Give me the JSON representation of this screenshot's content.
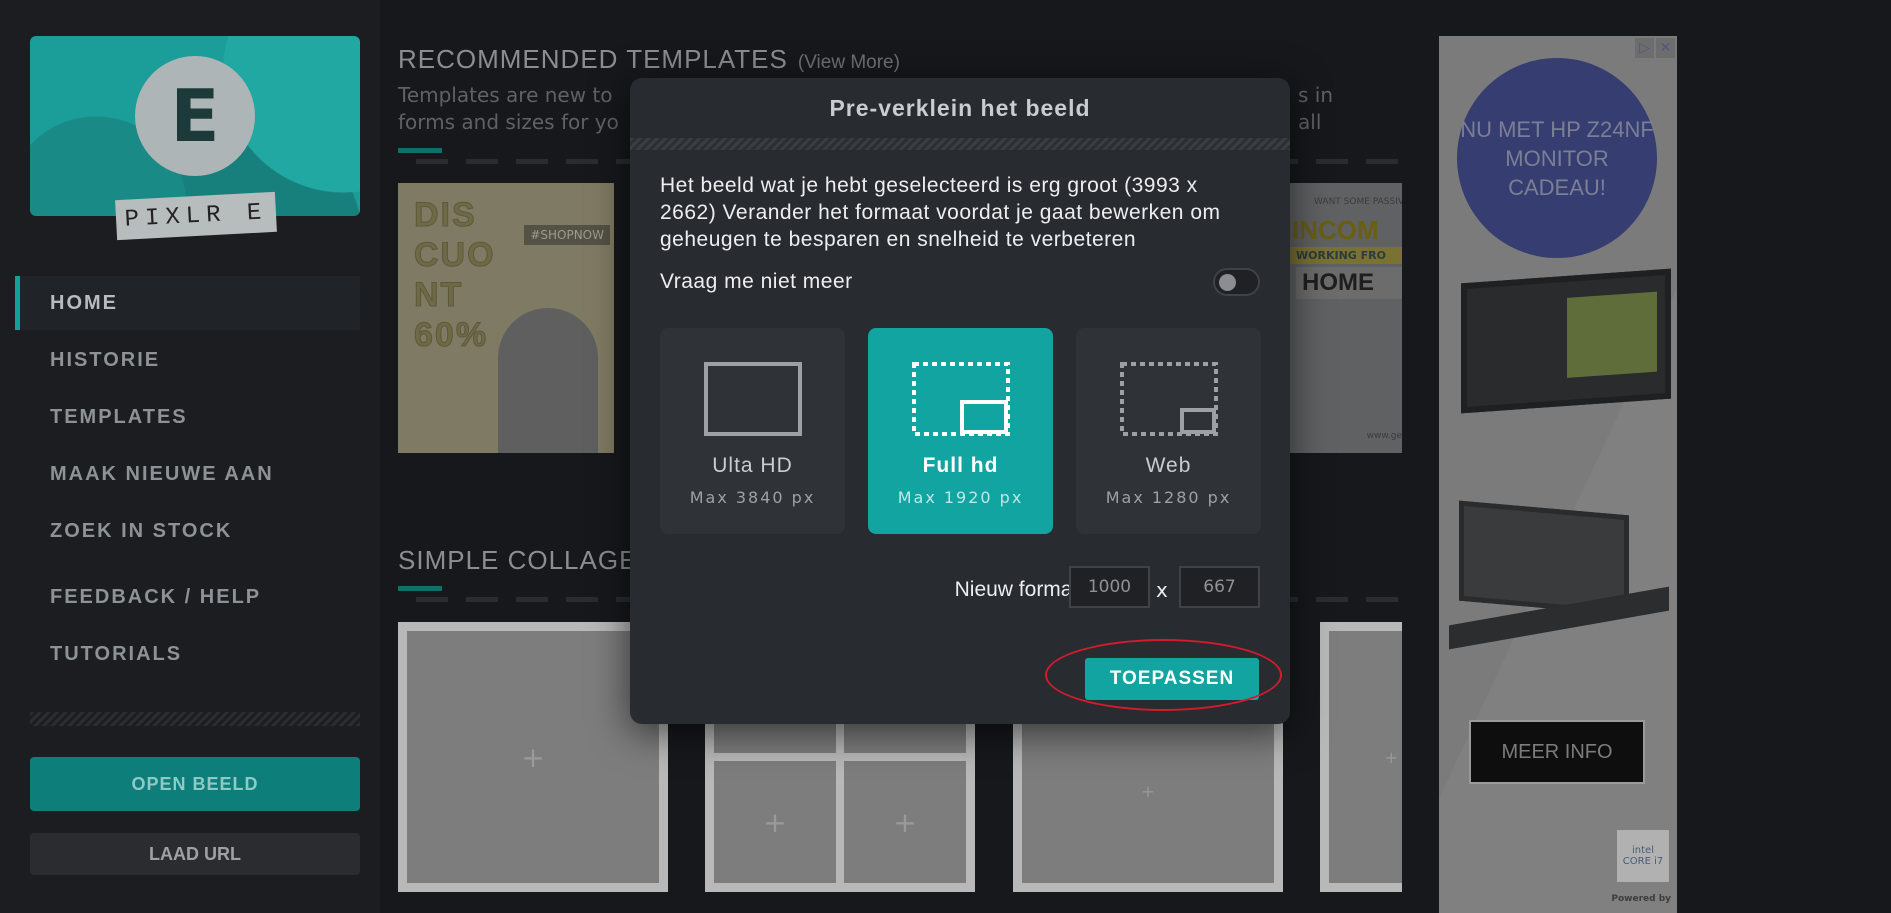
{
  "sidebar": {
    "logo_letter": "E",
    "logo_text": "PIXLR E",
    "nav": [
      {
        "label": "HOME",
        "active": true
      },
      {
        "label": "HISTORIE"
      },
      {
        "label": "TEMPLATES"
      },
      {
        "label": "MAAK NIEUWE AAN"
      },
      {
        "label": "ZOEK IN STOCK"
      },
      {
        "label": "FEEDBACK / HELP"
      },
      {
        "label": "TUTORIALS"
      }
    ],
    "open_button": "OPEN BEELD",
    "url_button": "LAAD URL"
  },
  "main": {
    "recommended_title": "RECOMMENDED TEMPLATES",
    "view_more": "(View More)",
    "recommended_desc_left": "Templates are new to",
    "recommended_desc_right": "s in all",
    "recommended_desc_line2": "forms and sizes for yo",
    "collage_title": "SIMPLE COLLAGE",
    "templates": {
      "discount_text": "DIS\nCUO\nNT\n60%",
      "discount_tag": "#SHOPNOW",
      "income_want": "WANT SOME PASSIV",
      "income_big": "INCOM",
      "income_working": "WORKING FRO",
      "income_home": "HOME",
      "income_url": "www.ge"
    },
    "plus": "+"
  },
  "ad": {
    "promo": "NU MET HP Z24NF MONITOR CADEAU!",
    "cta": "MEER INFO",
    "intel": "intel CORE i7",
    "powered": "Powered by"
  },
  "dialog": {
    "title": "Pre-verklein het beeld",
    "message": "Het beeld wat je hebt geselecteerd is erg groot (3993 x 2662) Verander het formaat voordat je gaat bewerken om geheugen te besparen en snelheid te verbeteren",
    "dont_ask": "Vraag me niet meer",
    "dont_ask_enabled": false,
    "options": [
      {
        "name": "Ulta HD",
        "max": "Max 3840 px",
        "selected": false
      },
      {
        "name": "Full hd",
        "max": "Max 1920 px",
        "selected": true
      },
      {
        "name": "Web",
        "max": "Max 1280 px",
        "selected": false
      }
    ],
    "format_label": "Nieuw formaat",
    "width_value": "1000",
    "height_value": "667",
    "times": "x",
    "apply_button": "TOEPASSEN"
  },
  "colors": {
    "accent": "#12a4a0",
    "highlight": "#d41b2c"
  }
}
